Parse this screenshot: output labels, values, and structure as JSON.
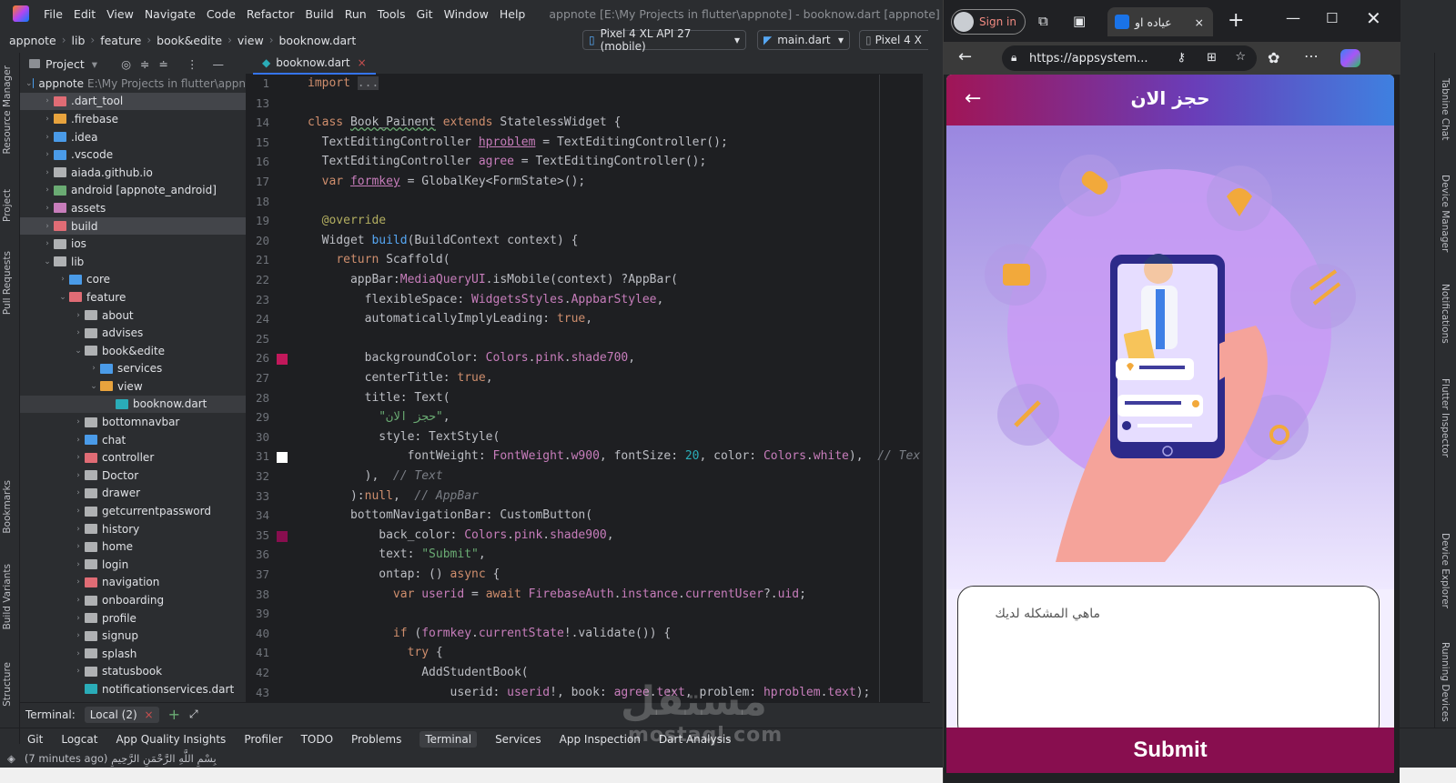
{
  "menubar": {
    "items": [
      "File",
      "Edit",
      "View",
      "Navigate",
      "Code",
      "Refactor",
      "Build",
      "Run",
      "Tools",
      "Git",
      "Window",
      "Help"
    ],
    "title": "appnote [E:\\My Projects in flutter\\appnote] - booknow.dart [appnote] - Administrator"
  },
  "navbar": {
    "crumbs": [
      "appnote",
      "lib",
      "feature",
      "book&edite",
      "view",
      "booknow.dart"
    ],
    "device": "Pixel 4 XL API 27 (mobile)",
    "run_config": "main.dart",
    "device2": "Pixel 4 X"
  },
  "left_strip": [
    "Resource Manager",
    "Project",
    "Pull Requests",
    "Bookmarks",
    "Build Variants",
    "Structure"
  ],
  "project": {
    "header": "Project",
    "rows": [
      {
        "indent": 0,
        "chev": "⌄",
        "name": "appnote",
        "extra": "E:\\My Projects in flutter\\appn",
        "color": "#4a9be8"
      },
      {
        "indent": 1,
        "chev": "›",
        "name": ".dart_tool",
        "color": "#e06c75",
        "hl": true
      },
      {
        "indent": 1,
        "chev": "›",
        "name": ".firebase",
        "color": "#e8a33d"
      },
      {
        "indent": 1,
        "chev": "›",
        "name": ".idea",
        "color": "#4a9be8"
      },
      {
        "indent": 1,
        "chev": "›",
        "name": ".vscode",
        "color": "#4a9be8"
      },
      {
        "indent": 1,
        "chev": "›",
        "name": "aiada.github.io",
        "color": "#afb1b3"
      },
      {
        "indent": 1,
        "chev": "›",
        "name": "android [appnote_android]",
        "color": "#6aab73"
      },
      {
        "indent": 1,
        "chev": "›",
        "name": "assets",
        "color": "#c77dbb"
      },
      {
        "indent": 1,
        "chev": "›",
        "name": "build",
        "color": "#e06c75",
        "hl": true
      },
      {
        "indent": 1,
        "chev": "›",
        "name": "ios",
        "color": "#afb1b3"
      },
      {
        "indent": 1,
        "chev": "⌄",
        "name": "lib",
        "color": "#afb1b3"
      },
      {
        "indent": 2,
        "chev": "›",
        "name": "core",
        "color": "#4a9be8"
      },
      {
        "indent": 2,
        "chev": "⌄",
        "name": "feature",
        "color": "#e06c75"
      },
      {
        "indent": 3,
        "chev": "›",
        "name": "about",
        "color": "#afb1b3"
      },
      {
        "indent": 3,
        "chev": "›",
        "name": "advises",
        "color": "#afb1b3"
      },
      {
        "indent": 3,
        "chev": "⌄",
        "name": "book&edite",
        "color": "#afb1b3"
      },
      {
        "indent": 4,
        "chev": "›",
        "name": "services",
        "color": "#4a9be8"
      },
      {
        "indent": 4,
        "chev": "⌄",
        "name": "view",
        "color": "#e8a33d"
      },
      {
        "indent": 5,
        "chev": "",
        "name": "booknow.dart",
        "color": "#2aacb8",
        "sel": true
      },
      {
        "indent": 3,
        "chev": "›",
        "name": "bottomnavbar",
        "color": "#afb1b3"
      },
      {
        "indent": 3,
        "chev": "›",
        "name": "chat",
        "color": "#4a9be8"
      },
      {
        "indent": 3,
        "chev": "›",
        "name": "controller",
        "color": "#e06c75"
      },
      {
        "indent": 3,
        "chev": "›",
        "name": "Doctor",
        "color": "#afb1b3"
      },
      {
        "indent": 3,
        "chev": "›",
        "name": "drawer",
        "color": "#afb1b3"
      },
      {
        "indent": 3,
        "chev": "›",
        "name": "getcurrentpassword",
        "color": "#afb1b3"
      },
      {
        "indent": 3,
        "chev": "›",
        "name": "history",
        "color": "#afb1b3"
      },
      {
        "indent": 3,
        "chev": "›",
        "name": "home",
        "color": "#afb1b3"
      },
      {
        "indent": 3,
        "chev": "›",
        "name": "login",
        "color": "#afb1b3"
      },
      {
        "indent": 3,
        "chev": "›",
        "name": "navigation",
        "color": "#e06c75"
      },
      {
        "indent": 3,
        "chev": "›",
        "name": "onboarding",
        "color": "#afb1b3"
      },
      {
        "indent": 3,
        "chev": "›",
        "name": "profile",
        "color": "#afb1b3"
      },
      {
        "indent": 3,
        "chev": "›",
        "name": "signup",
        "color": "#afb1b3"
      },
      {
        "indent": 3,
        "chev": "›",
        "name": "splash",
        "color": "#afb1b3"
      },
      {
        "indent": 3,
        "chev": "›",
        "name": "statusbook",
        "color": "#afb1b3"
      },
      {
        "indent": 3,
        "chev": "",
        "name": "notificationservices.dart",
        "color": "#2aacb8"
      }
    ]
  },
  "editor": {
    "tab": "booknow.dart",
    "lines": [
      {
        "n": "1",
        "h": "<span class=\"kw\">import</span> <span style=\"background:#3a3b3f;color:#8c8f94\">...</span>"
      },
      {
        "n": "13",
        "h": ""
      },
      {
        "n": "14",
        "h": "<span class=\"kw\">class</span> <span style=\"text-decoration:underline wavy #6aab73\">Book_Painent</span> <span class=\"kw\">extends</span> StatelessWidget {"
      },
      {
        "n": "15",
        "h": "  TextEditingController <span class=\"vr\" style=\"text-decoration:underline\">hproblem</span> = TextEditingController();"
      },
      {
        "n": "16",
        "h": "  TextEditingController <span class=\"vr\">agree</span> = TextEditingController();"
      },
      {
        "n": "17",
        "h": "  <span class=\"kw\">var</span> <span class=\"vr\" style=\"text-decoration:underline\">formkey</span> = GlobalKey&lt;FormState&gt;();"
      },
      {
        "n": "18",
        "h": ""
      },
      {
        "n": "19",
        "h": "  <span class=\"ann\">@override</span>"
      },
      {
        "n": "20",
        "h": "  Widget <span class=\"fn\">build</span>(BuildContext context) {"
      },
      {
        "n": "21",
        "h": "    <span class=\"kw\">return</span> Scaffold("
      },
      {
        "n": "22",
        "h": "      appBar:<span class=\"ty\">MediaQueryUI</span>.isMobile(context) ?AppBar("
      },
      {
        "n": "23",
        "h": "        flexibleSpace: <span class=\"ty\">WidgetsStyles</span>.<span class=\"vr\">AppbarStylee</span>,"
      },
      {
        "n": "24",
        "h": "        automaticallyImplyLeading: <span class=\"kw\">true</span>,"
      },
      {
        "n": "25",
        "h": ""
      },
      {
        "n": "26",
        "h": "        backgroundColor: <span class=\"ty\">Colors</span>.<span class=\"vr\">pink</span>.<span class=\"vr\">shade700</span>,"
      },
      {
        "n": "27",
        "h": "        centerTitle: <span class=\"kw\">true</span>,"
      },
      {
        "n": "28",
        "h": "        title: Text("
      },
      {
        "n": "29",
        "h": "          <span class=\"str\">\"حجز الان\"</span>,"
      },
      {
        "n": "30",
        "h": "          style: TextStyle("
      },
      {
        "n": "31",
        "h": "              fontWeight: <span class=\"ty\">FontWeight</span>.<span class=\"vr\">w900</span>, fontSize: <span class=\"num\">20</span>, color: <span class=\"ty\">Colors</span>.<span class=\"vr\">white</span>),  <span class=\"cm\">// Tex</span>"
      },
      {
        "n": "32",
        "h": "        ),  <span class=\"cm\">// Text</span>"
      },
      {
        "n": "33",
        "h": "      ):<span class=\"kw\">null</span>,  <span class=\"cm\">// AppBar</span>"
      },
      {
        "n": "34",
        "h": "      bottomNavigationBar: CustomButton("
      },
      {
        "n": "35",
        "h": "          back_color: <span class=\"ty\">Colors</span>.<span class=\"vr\">pink</span>.<span class=\"vr\">shade900</span>,"
      },
      {
        "n": "36",
        "h": "          text: <span class=\"str\">\"Submit\"</span>,"
      },
      {
        "n": "37",
        "h": "          ontap: () <span class=\"kw\">async</span> {"
      },
      {
        "n": "38",
        "h": "            <span class=\"kw\">var</span> <span class=\"vr\">userid</span> = <span class=\"kw\">await</span> <span class=\"ty\">FirebaseAuth</span>.<span class=\"vr\">instance</span>.<span class=\"vr\">currentUser</span>?.<span class=\"vr\">uid</span>;"
      },
      {
        "n": "39",
        "h": ""
      },
      {
        "n": "40",
        "h": "            <span class=\"kw\">if</span> (<span class=\"vr\">formkey</span>.<span class=\"vr\">currentState</span>!.validate()) {"
      },
      {
        "n": "41",
        "h": "              <span class=\"kw\">try</span> {"
      },
      {
        "n": "42",
        "h": "                AddStudentBook("
      },
      {
        "n": "43",
        "h": "                    userid: <span class=\"vr\">userid</span>!, book: <span class=\"vr\">agree</span>.<span class=\"vr\">text</span>, problem: <span class=\"vr\">hproblem</span>.<span class=\"vr\">text</span>);"
      }
    ]
  },
  "terminal": {
    "label": "Terminal:",
    "tab": "Local (2)"
  },
  "toolwins": [
    "Git",
    "Logcat",
    "App Quality Insights",
    "Profiler",
    "TODO",
    "Problems",
    "Terminal",
    "Services",
    "App Inspection",
    "Dart Analysis"
  ],
  "status": "(7 minutes ago) بِسْمِ اللَّهِ الرَّحْمَنِ الرَّحِيمِ",
  "right_strip": [
    "Tabnine Chat",
    "Device Manager",
    "Notifications",
    "Flutter Inspector",
    "Device Explorer",
    "Running Devices"
  ],
  "browser": {
    "signin": "Sign in",
    "tab_title": "عياده او",
    "url": "https://appsystem..."
  },
  "app": {
    "title": "حجز الان",
    "placeholder": "ماهي المشكله لديك",
    "submit": "Submit"
  },
  "watermark": {
    "ar": "مستقل",
    "en": "mostaql.com"
  },
  "colors": {
    "appbar_start": "#a01556",
    "submit_bg": "#880e4f",
    "accent": "#3574f0"
  }
}
